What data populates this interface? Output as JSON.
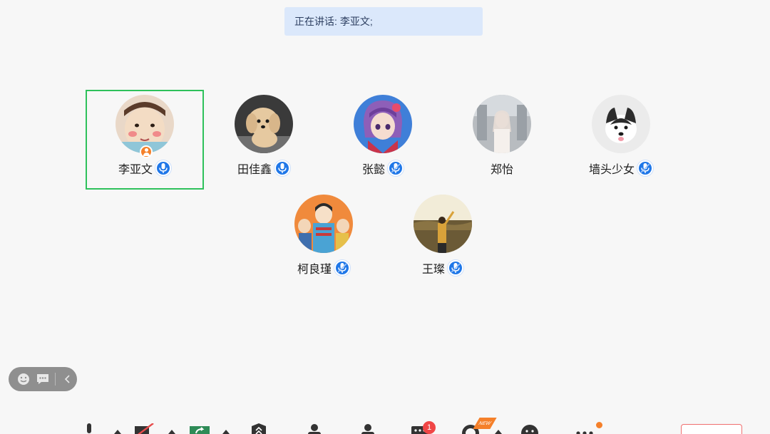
{
  "speaking_banner": {
    "label": "正在讲话:",
    "speaker": "李亚文;"
  },
  "participants": [
    {
      "name": "李亚文",
      "avatar": "baby-face-avatar",
      "active": true,
      "host": true,
      "mic": "mic-on"
    },
    {
      "name": "田佳鑫",
      "avatar": "puppy-avatar",
      "active": false,
      "host": false,
      "mic": "mic-on"
    },
    {
      "name": "张懿",
      "avatar": "anime-girl-avatar",
      "active": false,
      "host": false,
      "mic": "mic-muted"
    },
    {
      "name": "郑怡",
      "avatar": "girl-photo-avatar",
      "active": false,
      "host": false,
      "mic": "none"
    },
    {
      "name": "墙头少女",
      "avatar": "husky-avatar",
      "active": false,
      "host": false,
      "mic": "mic-muted"
    },
    {
      "name": "柯良瑾",
      "avatar": "cartoon-group-avatar",
      "active": false,
      "host": false,
      "mic": "mic-muted"
    },
    {
      "name": "王璨",
      "avatar": "field-photo-avatar",
      "active": false,
      "host": false,
      "mic": "mic-muted"
    }
  ],
  "toolbar": {
    "chat_badge_count": "1",
    "new_tag": "NEW"
  },
  "colors": {
    "active_border": "#2ec15b",
    "mic_blue": "#1f77e8",
    "host_orange": "#f5802a",
    "banner_bg": "#dbe8fb"
  }
}
